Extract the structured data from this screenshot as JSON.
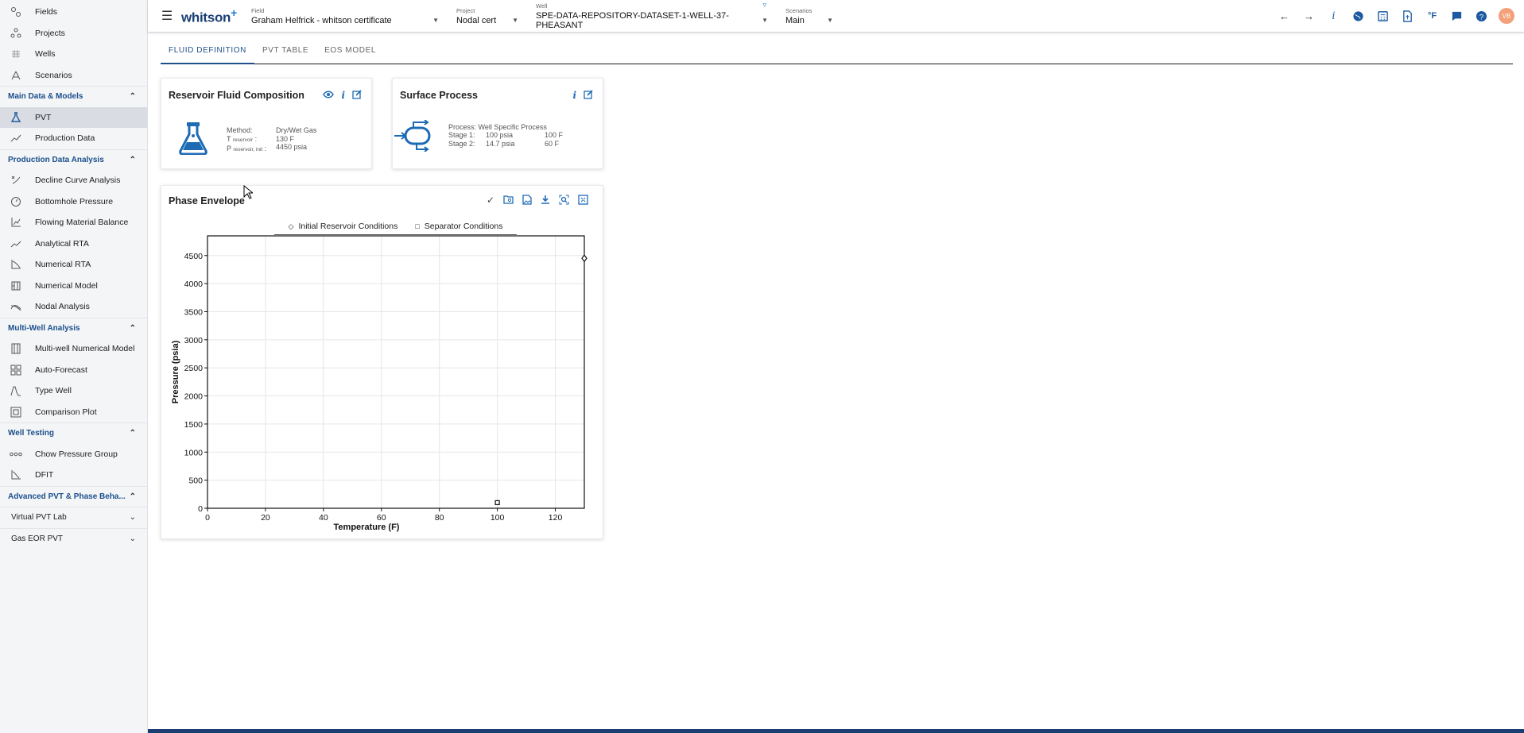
{
  "sidebar": {
    "top_items": [
      {
        "label": "Fields",
        "icon": "fields-icon"
      },
      {
        "label": "Projects",
        "icon": "projects-icon"
      },
      {
        "label": "Wells",
        "icon": "wells-icon"
      },
      {
        "label": "Scenarios",
        "icon": "scenarios-icon"
      }
    ],
    "sections": [
      {
        "title": "Main Data & Models",
        "items": [
          {
            "label": "PVT",
            "icon": "flask-icon",
            "active": true
          },
          {
            "label": "Production Data",
            "icon": "production-icon"
          }
        ]
      },
      {
        "title": "Production Data Analysis",
        "items": [
          {
            "label": "Decline Curve Analysis",
            "icon": "decline-icon"
          },
          {
            "label": "Bottomhole Pressure",
            "icon": "gauge-icon"
          },
          {
            "label": "Flowing Material Balance",
            "icon": "fmb-icon"
          },
          {
            "label": "Analytical RTA",
            "icon": "rta-icon"
          },
          {
            "label": "Numerical RTA",
            "icon": "num-rta-icon"
          },
          {
            "label": "Numerical Model",
            "icon": "num-model-icon"
          },
          {
            "label": "Nodal Analysis",
            "icon": "nodal-icon"
          }
        ]
      },
      {
        "title": "Multi-Well Analysis",
        "items": [
          {
            "label": "Multi-well Numerical Model",
            "icon": "multiwell-icon"
          },
          {
            "label": "Auto-Forecast",
            "icon": "grid-icon"
          },
          {
            "label": "Type Well",
            "icon": "typewell-icon"
          },
          {
            "label": "Comparison Plot",
            "icon": "comparison-icon"
          }
        ]
      },
      {
        "title": "Well Testing",
        "items": [
          {
            "label": "Chow Pressure Group",
            "icon": "dots-icon"
          },
          {
            "label": "DFIT",
            "icon": "dfit-icon"
          }
        ]
      }
    ],
    "adv_section": "Advanced PVT & Phase Beha...",
    "collapsed": [
      "Virtual PVT Lab",
      "Gas EOR PVT"
    ]
  },
  "topbar": {
    "logo": "whitson",
    "logo_plus": "+",
    "field_label": "Field",
    "field_value": "Graham Helfrick - whitson certificate",
    "project_label": "Project",
    "project_value": "Nodal cert",
    "well_label": "Well",
    "well_value": "SPE-DATA-REPOSITORY-DATASET-1-WELL-37-PHEASANT",
    "scenario_label": "Scenarios",
    "scenario_value": "Main",
    "units": "°F",
    "avatar": "VB"
  },
  "tabs": [
    "FLUID DEFINITION",
    "PVT TABLE",
    "EOS MODEL"
  ],
  "reservoir_card": {
    "title": "Reservoir Fluid Composition",
    "method_label": "Method:",
    "method_value": "Dry/Wet Gas",
    "t_label": "T",
    "t_sub": "reservoir",
    "t_value": "130 F",
    "p_label": "P",
    "p_sub": "reservoir, init",
    "p_value": "4450 psia"
  },
  "surface_card": {
    "title": "Surface Process",
    "process_label": "Process:",
    "process_value": "Well Specific Process",
    "stage1_label": "Stage 1:",
    "stage1_p": "100 psia",
    "stage1_t": "100 F",
    "stage2_label": "Stage 2:",
    "stage2_p": "14.7 psia",
    "stage2_t": "60 F"
  },
  "phase_card": {
    "title": "Phase Envelope"
  },
  "chart_data": {
    "type": "scatter",
    "xlabel": "Temperature (F)",
    "ylabel": "Pressure (psia)",
    "xlim": [
      0,
      130
    ],
    "ylim": [
      0,
      4850
    ],
    "xticks": [
      0,
      20,
      40,
      60,
      80,
      100,
      120
    ],
    "yticks": [
      0,
      500,
      1000,
      1500,
      2000,
      2500,
      3000,
      3500,
      4000,
      4500
    ],
    "grid": true,
    "legend_position": "top",
    "series": [
      {
        "name": "Initial Reservoir Conditions",
        "marker": "diamond",
        "x": [
          130
        ],
        "y": [
          4450
        ]
      },
      {
        "name": "Separator Conditions",
        "marker": "square",
        "x": [
          100
        ],
        "y": [
          100
        ]
      }
    ]
  }
}
